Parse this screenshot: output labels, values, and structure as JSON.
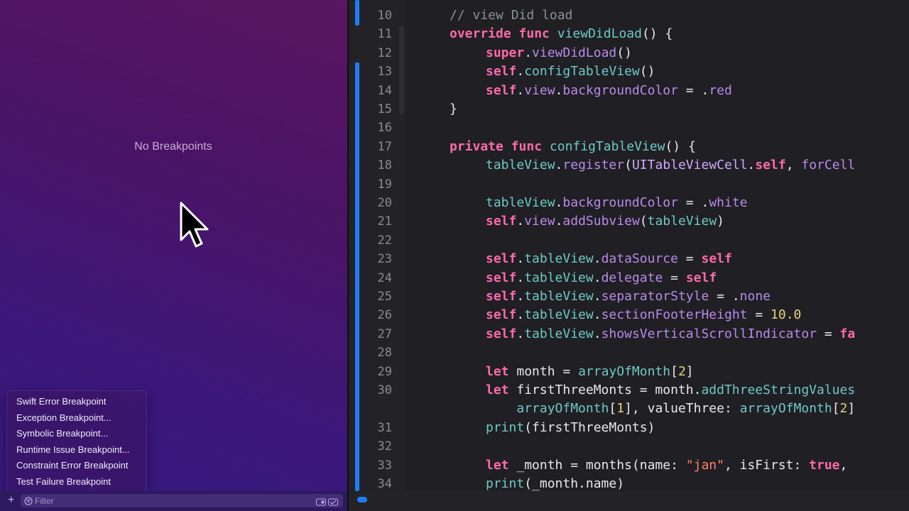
{
  "navigator": {
    "empty_state": "No Breakpoints",
    "menu_items": [
      "Swift Error Breakpoint",
      "Exception Breakpoint...",
      "Symbolic Breakpoint...",
      "Runtime Issue Breakpoint...",
      "Constraint Error Breakpoint",
      "Test Failure Breakpoint"
    ],
    "filter": {
      "placeholder": "Filter",
      "value": "",
      "add_label": "+"
    }
  },
  "editor": {
    "lines": [
      {
        "n": "10",
        "parts": [
          [
            "cm",
            "// view Did load"
          ]
        ]
      },
      {
        "n": "11",
        "parts": [
          [
            "kw",
            "override"
          ],
          [
            "pl",
            " "
          ],
          [
            "kw",
            "func"
          ],
          [
            "pl",
            " "
          ],
          [
            "fn",
            "viewDidLoad"
          ],
          [
            "pl",
            "() {"
          ]
        ]
      },
      {
        "n": "12",
        "parts": [
          [
            "kw",
            "super"
          ],
          [
            "pl",
            "."
          ],
          [
            "prop",
            "viewDidLoad"
          ],
          [
            "pl",
            "()"
          ]
        ]
      },
      {
        "n": "13",
        "parts": [
          [
            "kw",
            "self"
          ],
          [
            "pl",
            "."
          ],
          [
            "fn",
            "configTableView"
          ],
          [
            "pl",
            "()"
          ]
        ]
      },
      {
        "n": "14",
        "parts": [
          [
            "kw",
            "self"
          ],
          [
            "pl",
            "."
          ],
          [
            "prop",
            "view"
          ],
          [
            "pl",
            "."
          ],
          [
            "prop",
            "backgroundColor"
          ],
          [
            "pl",
            " = ."
          ],
          [
            "prop",
            "red"
          ]
        ]
      },
      {
        "n": "15",
        "parts": [
          [
            "pl",
            "}"
          ]
        ]
      },
      {
        "n": "16",
        "parts": []
      },
      {
        "n": "17",
        "parts": [
          [
            "kw",
            "private"
          ],
          [
            "pl",
            " "
          ],
          [
            "kw",
            "func"
          ],
          [
            "pl",
            " "
          ],
          [
            "fn",
            "configTableView"
          ],
          [
            "pl",
            "() {"
          ]
        ]
      },
      {
        "n": "18",
        "parts": [
          [
            "fn",
            "tableView"
          ],
          [
            "pl",
            "."
          ],
          [
            "prop",
            "register"
          ],
          [
            "pl",
            "("
          ],
          [
            "typ",
            "UITableViewCell"
          ],
          [
            "pl",
            "."
          ],
          [
            "kw",
            "self"
          ],
          [
            "pl",
            ", "
          ],
          [
            "prop",
            "forCell"
          ]
        ]
      },
      {
        "n": "19",
        "parts": []
      },
      {
        "n": "20",
        "parts": [
          [
            "fn",
            "tableView"
          ],
          [
            "pl",
            "."
          ],
          [
            "prop",
            "backgroundColor"
          ],
          [
            "pl",
            " = ."
          ],
          [
            "prop",
            "white"
          ]
        ]
      },
      {
        "n": "21",
        "parts": [
          [
            "kw",
            "self"
          ],
          [
            "pl",
            "."
          ],
          [
            "prop",
            "view"
          ],
          [
            "pl",
            "."
          ],
          [
            "prop",
            "addSubview"
          ],
          [
            "pl",
            "("
          ],
          [
            "fn",
            "tableView"
          ],
          [
            "pl",
            ")"
          ]
        ]
      },
      {
        "n": "22",
        "parts": []
      },
      {
        "n": "23",
        "parts": [
          [
            "kw",
            "self"
          ],
          [
            "pl",
            "."
          ],
          [
            "fn",
            "tableView"
          ],
          [
            "pl",
            "."
          ],
          [
            "prop",
            "dataSource"
          ],
          [
            "pl",
            " = "
          ],
          [
            "kw",
            "self"
          ]
        ]
      },
      {
        "n": "24",
        "parts": [
          [
            "kw",
            "self"
          ],
          [
            "pl",
            "."
          ],
          [
            "fn",
            "tableView"
          ],
          [
            "pl",
            "."
          ],
          [
            "prop",
            "delegate"
          ],
          [
            "pl",
            " = "
          ],
          [
            "kw",
            "self"
          ]
        ]
      },
      {
        "n": "25",
        "parts": [
          [
            "kw",
            "self"
          ],
          [
            "pl",
            "."
          ],
          [
            "fn",
            "tableView"
          ],
          [
            "pl",
            "."
          ],
          [
            "prop",
            "separatorStyle"
          ],
          [
            "pl",
            " = ."
          ],
          [
            "prop",
            "none"
          ]
        ]
      },
      {
        "n": "26",
        "parts": [
          [
            "kw",
            "self"
          ],
          [
            "pl",
            "."
          ],
          [
            "fn",
            "tableView"
          ],
          [
            "pl",
            "."
          ],
          [
            "prop",
            "sectionFooterHeight"
          ],
          [
            "pl",
            " = "
          ],
          [
            "num",
            "10.0"
          ]
        ]
      },
      {
        "n": "27",
        "parts": [
          [
            "kw",
            "self"
          ],
          [
            "pl",
            "."
          ],
          [
            "fn",
            "tableView"
          ],
          [
            "pl",
            "."
          ],
          [
            "prop",
            "showsVerticalScrollIndicator"
          ],
          [
            "pl",
            " = "
          ],
          [
            "kw",
            "fa"
          ]
        ]
      },
      {
        "n": "28",
        "parts": []
      },
      {
        "n": "29",
        "parts": [
          [
            "kw",
            "let"
          ],
          [
            "pl",
            " month = "
          ],
          [
            "fn",
            "arrayOfMonth"
          ],
          [
            "pl",
            "["
          ],
          [
            "num",
            "2"
          ],
          [
            "pl",
            "]"
          ]
        ]
      },
      {
        "n": "30",
        "parts": [
          [
            "kw",
            "let"
          ],
          [
            "pl",
            " firstThreeMonts = month."
          ],
          [
            "fn",
            "addThreeStringValues"
          ]
        ]
      },
      {
        "n": "",
        "parts": [
          [
            "pl",
            "    "
          ],
          [
            "fn",
            "arrayOfMonth"
          ],
          [
            "pl",
            "["
          ],
          [
            "num",
            "1"
          ],
          [
            "pl",
            "], valueThree: "
          ],
          [
            "fn",
            "arrayOfMonth"
          ],
          [
            "pl",
            "["
          ],
          [
            "num",
            "2"
          ],
          [
            "pl",
            "]"
          ]
        ]
      },
      {
        "n": "31",
        "parts": [
          [
            "fn",
            "print"
          ],
          [
            "pl",
            "(firstThreeMonts)"
          ]
        ]
      },
      {
        "n": "32",
        "parts": []
      },
      {
        "n": "33",
        "parts": [
          [
            "kw",
            "let"
          ],
          [
            "pl",
            " _month = months(name: "
          ],
          [
            "str",
            "\"jan\""
          ],
          [
            "pl",
            ", isFirst: "
          ],
          [
            "kw",
            "true"
          ],
          [
            "pl",
            ","
          ]
        ]
      },
      {
        "n": "34",
        "parts": [
          [
            "fn",
            "print"
          ],
          [
            "pl",
            "(_month.name)"
          ]
        ]
      }
    ]
  }
}
